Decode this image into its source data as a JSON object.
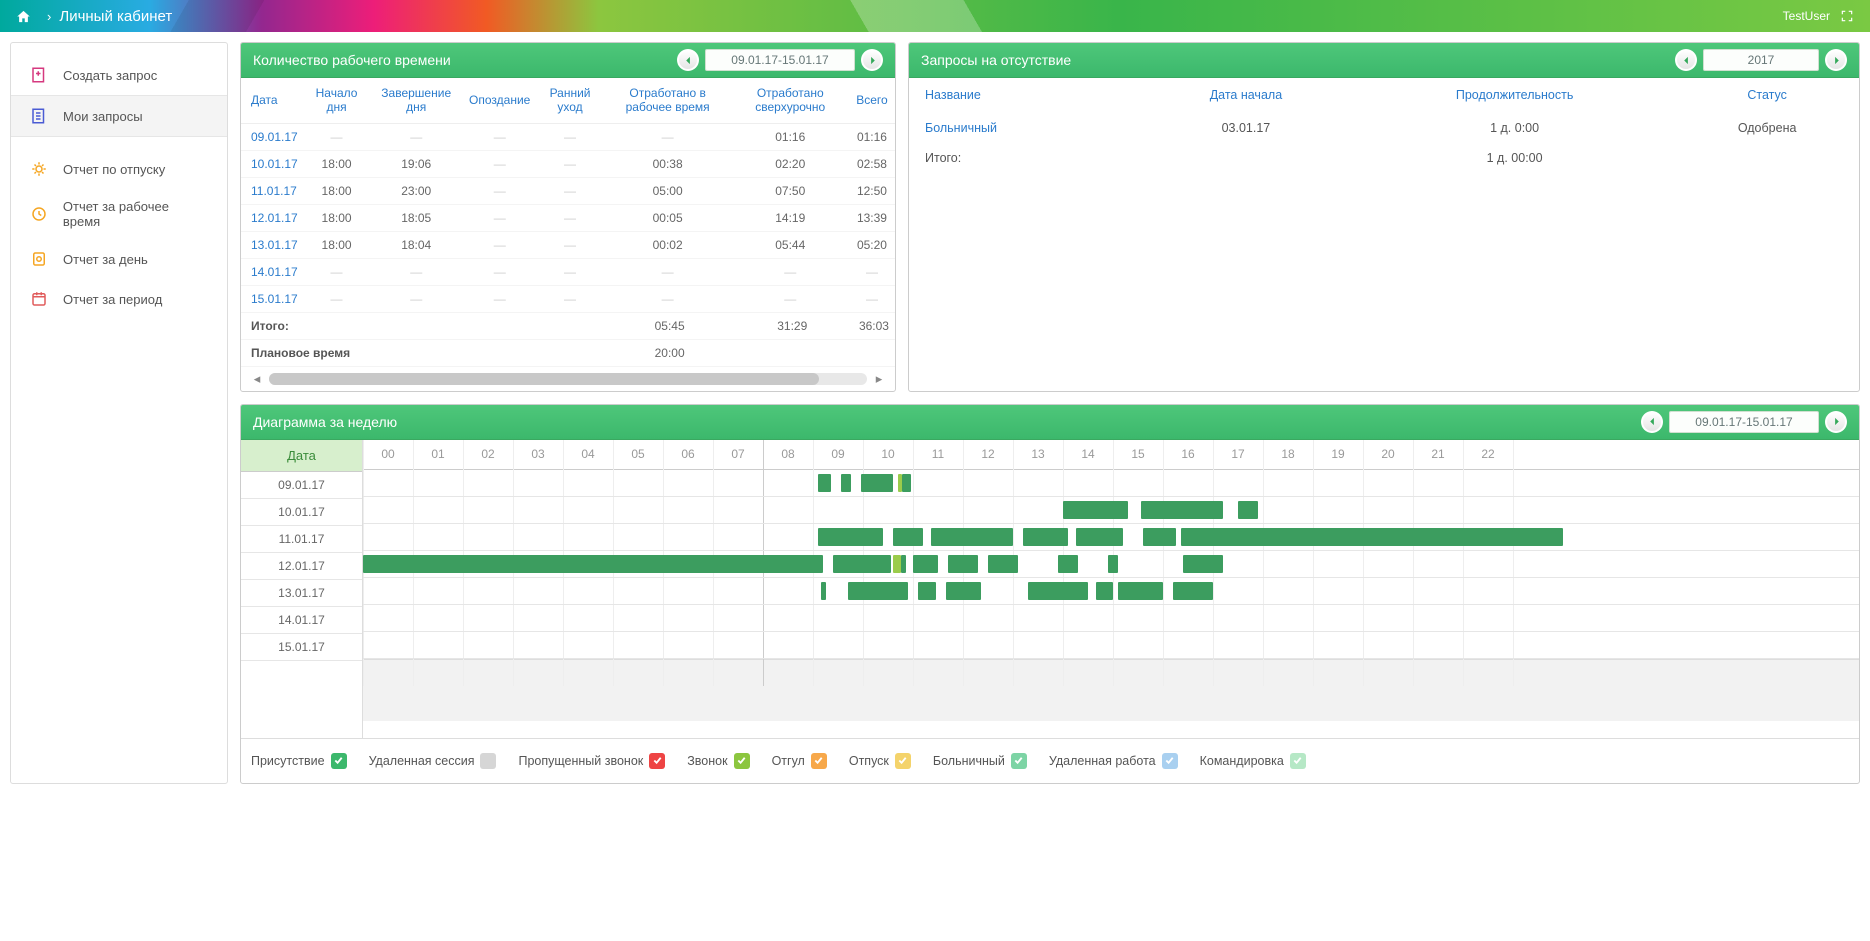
{
  "topbar": {
    "title": "Личный кабинет",
    "user": "TestUser"
  },
  "sidebar": {
    "create": "Создать запрос",
    "my": "Мои запросы",
    "vacation": "Отчет по отпуску",
    "worktime": "Отчет за рабочее время",
    "day": "Отчет за день",
    "period": "Отчет за период"
  },
  "worktime_panel": {
    "title": "Количество рабочего времени",
    "range": "09.01.17-15.01.17",
    "headers": {
      "date": "Дата",
      "start": "Начало дня",
      "end": "Завершение дня",
      "late": "Опоздание",
      "early": "Ранний уход",
      "worked": "Отработано в рабочее время",
      "over": "Отработано сверхурочно",
      "total": "Всего"
    },
    "rows": [
      {
        "date": "09.01.17",
        "start": "—",
        "end": "—",
        "late": "—",
        "early": "—",
        "worked": "—",
        "over": "01:16",
        "total": "01:16"
      },
      {
        "date": "10.01.17",
        "start": "18:00",
        "end": "19:06",
        "late": "—",
        "early": "—",
        "worked": "00:38",
        "over": "02:20",
        "total": "02:58"
      },
      {
        "date": "11.01.17",
        "start": "18:00",
        "end": "23:00",
        "late": "—",
        "early": "—",
        "worked": "05:00",
        "over": "07:50",
        "total": "12:50"
      },
      {
        "date": "12.01.17",
        "start": "18:00",
        "end": "18:05",
        "late": "—",
        "early": "—",
        "worked": "00:05",
        "over": "14:19",
        "total": "13:39"
      },
      {
        "date": "13.01.17",
        "start": "18:00",
        "end": "18:04",
        "late": "—",
        "early": "—",
        "worked": "00:02",
        "over": "05:44",
        "total": "05:20"
      },
      {
        "date": "14.01.17",
        "start": "—",
        "end": "—",
        "late": "—",
        "early": "—",
        "worked": "—",
        "over": "—",
        "total": "—"
      },
      {
        "date": "15.01.17",
        "start": "—",
        "end": "—",
        "late": "—",
        "early": "—",
        "worked": "—",
        "over": "—",
        "total": "—"
      }
    ],
    "total": {
      "label": "Итого:",
      "worked": "05:45",
      "over": "31:29",
      "total": "36:03"
    },
    "plan": {
      "label": "Плановое время",
      "worked": "20:00"
    }
  },
  "absence_panel": {
    "title": "Запросы на отсутствие",
    "year": "2017",
    "headers": {
      "name": "Название",
      "start": "Дата начала",
      "dur": "Продолжительность",
      "status": "Статус"
    },
    "rows": [
      {
        "name": "Больничный",
        "start": "03.01.17",
        "dur": "1 д. 0:00",
        "status": "Одобрена"
      }
    ],
    "total": {
      "label": "Итого:",
      "dur": "1 д. 00:00"
    }
  },
  "chart_panel": {
    "title": "Диаграмма за неделю",
    "range": "09.01.17-15.01.17",
    "date_header": "Дата",
    "dates": [
      "09.01.17",
      "10.01.17",
      "11.01.17",
      "12.01.17",
      "13.01.17",
      "14.01.17",
      "15.01.17"
    ],
    "hours": [
      "00",
      "01",
      "02",
      "03",
      "04",
      "05",
      "06",
      "07",
      "08",
      "09",
      "10",
      "11",
      "12",
      "13",
      "14",
      "15",
      "16",
      "17",
      "18",
      "19",
      "20",
      "21",
      "22"
    ]
  },
  "chart_data": {
    "type": "gantt",
    "xlabel_unit": "hour_of_day",
    "xlim": [
      0,
      24
    ],
    "categories": [
      "09.01.17",
      "10.01.17",
      "11.01.17",
      "12.01.17",
      "13.01.17",
      "14.01.17",
      "15.01.17"
    ],
    "series": {
      "09.01.17": [
        {
          "start": 9.1,
          "end": 9.35,
          "type": "presence"
        },
        {
          "start": 9.55,
          "end": 9.75,
          "type": "presence"
        },
        {
          "start": 9.95,
          "end": 10.6,
          "type": "presence"
        },
        {
          "start": 10.7,
          "end": 10.78,
          "type": "call"
        },
        {
          "start": 10.78,
          "end": 10.95,
          "type": "presence"
        }
      ],
      "10.01.17": [
        {
          "start": 14.0,
          "end": 15.3,
          "type": "presence"
        },
        {
          "start": 15.55,
          "end": 17.2,
          "type": "presence"
        },
        {
          "start": 17.5,
          "end": 17.9,
          "type": "presence"
        }
      ],
      "11.01.17": [
        {
          "start": 9.1,
          "end": 10.4,
          "type": "presence"
        },
        {
          "start": 10.6,
          "end": 11.2,
          "type": "presence"
        },
        {
          "start": 11.35,
          "end": 13.0,
          "type": "presence"
        },
        {
          "start": 13.2,
          "end": 14.1,
          "type": "presence"
        },
        {
          "start": 14.25,
          "end": 15.2,
          "type": "presence"
        },
        {
          "start": 15.6,
          "end": 16.25,
          "type": "presence"
        },
        {
          "start": 16.35,
          "end": 24.0,
          "type": "presence"
        }
      ],
      "12.01.17": [
        {
          "start": 0.0,
          "end": 9.2,
          "type": "presence"
        },
        {
          "start": 9.4,
          "end": 10.55,
          "type": "presence"
        },
        {
          "start": 10.6,
          "end": 10.75,
          "type": "call"
        },
        {
          "start": 10.75,
          "end": 10.85,
          "type": "presence"
        },
        {
          "start": 11.0,
          "end": 11.5,
          "type": "presence"
        },
        {
          "start": 11.7,
          "end": 12.3,
          "type": "presence"
        },
        {
          "start": 12.5,
          "end": 13.1,
          "type": "presence"
        },
        {
          "start": 13.9,
          "end": 14.3,
          "type": "presence"
        },
        {
          "start": 14.9,
          "end": 15.1,
          "type": "presence"
        },
        {
          "start": 16.4,
          "end": 17.2,
          "type": "presence"
        }
      ],
      "13.01.17": [
        {
          "start": 9.15,
          "end": 9.25,
          "type": "presence"
        },
        {
          "start": 9.7,
          "end": 10.9,
          "type": "presence"
        },
        {
          "start": 11.1,
          "end": 11.45,
          "type": "presence"
        },
        {
          "start": 11.65,
          "end": 12.35,
          "type": "presence"
        },
        {
          "start": 13.3,
          "end": 14.5,
          "type": "presence"
        },
        {
          "start": 14.65,
          "end": 15.0,
          "type": "presence"
        },
        {
          "start": 15.1,
          "end": 16.0,
          "type": "presence"
        },
        {
          "start": 16.2,
          "end": 17.0,
          "type": "presence"
        }
      ],
      "14.01.17": [],
      "15.01.17": []
    },
    "marker_hour": 8.0
  },
  "legend": {
    "presence": "Присутствие",
    "remote_session": "Удаленная сессия",
    "missed_call": "Пропущенный звонок",
    "call": "Звонок",
    "dayoff": "Отгул",
    "vacation": "Отпуск",
    "sick": "Больничный",
    "remote_work": "Удаленная работа",
    "trip": "Командировка"
  }
}
